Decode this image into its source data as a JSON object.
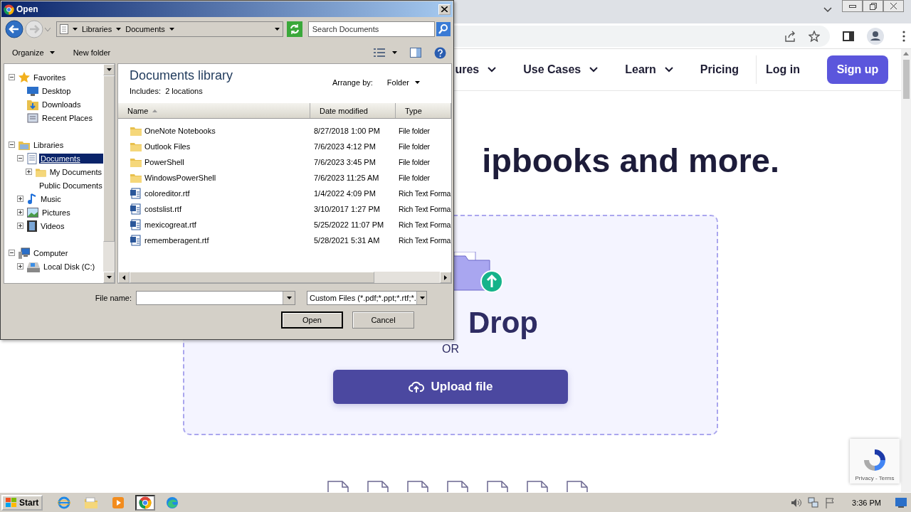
{
  "browser": {
    "nav_items": [
      {
        "label": "ures",
        "dropdown": true
      },
      {
        "label": "Use Cases",
        "dropdown": true
      },
      {
        "label": "Learn",
        "dropdown": true
      },
      {
        "label": "Pricing",
        "dropdown": false
      }
    ],
    "login": "Log in",
    "signup": "Sign up",
    "heading": "ipbooks and more.",
    "dropzone": {
      "title": "Drop",
      "separator": "OR",
      "upload_button": "Upload file"
    },
    "recaptcha_links": "Privacy - Terms"
  },
  "dialog": {
    "title": "Open",
    "breadcrumbs": [
      "Libraries",
      "Documents"
    ],
    "search": {
      "placeholder": "Search Documents"
    },
    "toolbar": [
      {
        "label": "Organize",
        "dropdown": true
      },
      {
        "label": "New folder",
        "dropdown": false
      }
    ],
    "tree": [
      {
        "kind": "favorites",
        "label": "Favorites",
        "selected": false,
        "expanded": true,
        "children": [
          {
            "kind": "desktop",
            "label": "Desktop",
            "selected": false
          },
          {
            "kind": "downloads",
            "label": "Downloads",
            "selected": false
          },
          {
            "kind": "recent",
            "label": "Recent Places",
            "selected": false
          }
        ]
      },
      {
        "kind": "libraries",
        "label": "Libraries",
        "selected": false,
        "expanded": true,
        "children": [
          {
            "kind": "documents",
            "label": "Documents",
            "selected": true,
            "expanded": true,
            "children": [
              {
                "kind": "folder",
                "label": "My Documents",
                "selected": false,
                "expanded": false
              },
              {
                "kind": "folder",
                "label": "Public Documents",
                "selected": false
              }
            ]
          },
          {
            "kind": "music",
            "label": "Music",
            "selected": false,
            "expanded": false
          },
          {
            "kind": "pictures",
            "label": "Pictures",
            "selected": false,
            "expanded": false
          },
          {
            "kind": "videos",
            "label": "Videos",
            "selected": false,
            "expanded": false
          }
        ]
      },
      {
        "kind": "computer",
        "label": "Computer",
        "selected": false,
        "expanded": true,
        "children": [
          {
            "kind": "disk",
            "label": "Local Disk (C:)",
            "selected": false,
            "expanded": false
          }
        ]
      }
    ],
    "library": {
      "title": "Documents library",
      "includes_label": "Includes:",
      "includes_value": "2 locations",
      "arrange_label": "Arrange by:",
      "arrange_value": "Folder"
    },
    "columns": [
      {
        "label": "Name",
        "sorted": true
      },
      {
        "label": "Date modified",
        "sorted": false
      },
      {
        "label": "Type",
        "sorted": false
      }
    ],
    "files": [
      {
        "kind": "folder",
        "name": "OneNote Notebooks",
        "date_modified": "8/27/2018 1:00 PM",
        "type": "File folder"
      },
      {
        "kind": "folder",
        "name": "Outlook Files",
        "date_modified": "7/6/2023 4:12 PM",
        "type": "File folder"
      },
      {
        "kind": "folder",
        "name": "PowerShell",
        "date_modified": "7/6/2023 3:45 PM",
        "type": "File folder"
      },
      {
        "kind": "folder",
        "name": "WindowsPowerShell",
        "date_modified": "7/6/2023 11:25 AM",
        "type": "File folder"
      },
      {
        "kind": "document",
        "name": "coloreditor.rtf",
        "date_modified": "1/4/2022 4:09 PM",
        "type": "Rich Text Forma"
      },
      {
        "kind": "document",
        "name": "costslist.rtf",
        "date_modified": "3/10/2017 1:27 PM",
        "type": "Rich Text Forma"
      },
      {
        "kind": "document",
        "name": "mexicogreat.rtf",
        "date_modified": "5/25/2022 11:07 PM",
        "type": "Rich Text Forma"
      },
      {
        "kind": "document",
        "name": "rememberagent.rtf",
        "date_modified": "5/28/2021 5:31 AM",
        "type": "Rich Text Forma"
      }
    ],
    "file_name_label": "File name:",
    "file_type_filter": "Custom Files (*.pdf;*.ppt;*.rtf;*.",
    "buttons": [
      {
        "label": "Open",
        "default": true
      },
      {
        "label": "Cancel",
        "default": false
      }
    ]
  },
  "taskbar": {
    "start": "Start",
    "apps": [
      {
        "kind": "ie",
        "selected": false
      },
      {
        "kind": "explorer",
        "selected": false
      },
      {
        "kind": "media",
        "selected": false
      },
      {
        "kind": "chrome",
        "selected": true
      },
      {
        "kind": "edge",
        "selected": false
      }
    ],
    "clock": "3:36 PM"
  }
}
